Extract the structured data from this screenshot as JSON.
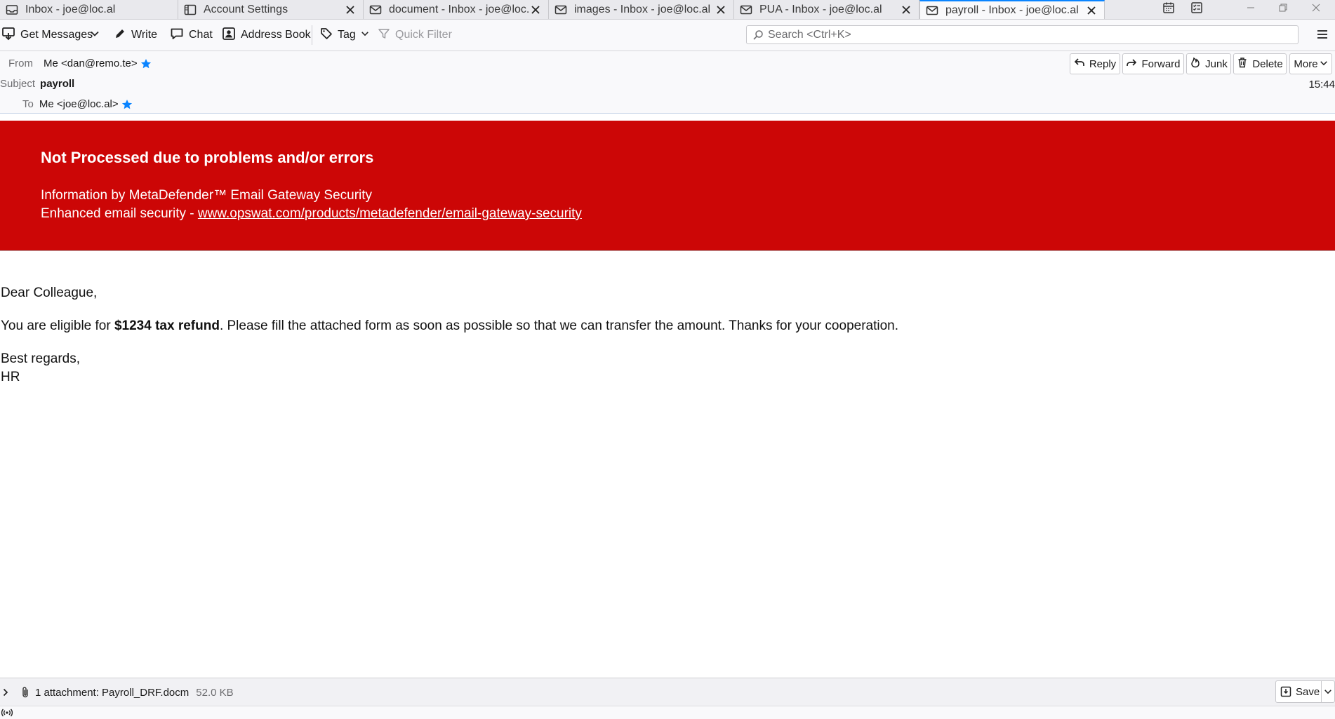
{
  "tabs": [
    {
      "label": "Inbox - joe@loc.al",
      "icon": "inbox-icon",
      "closable": false,
      "active": false
    },
    {
      "label": "Account Settings",
      "icon": "settings-page-icon",
      "closable": true,
      "active": false
    },
    {
      "label": "document - Inbox - joe@loc.al",
      "icon": "envelope-icon",
      "closable": true,
      "active": false
    },
    {
      "label": "images - Inbox - joe@loc.al",
      "icon": "envelope-icon",
      "closable": true,
      "active": false
    },
    {
      "label": "PUA - Inbox - joe@loc.al",
      "icon": "envelope-icon",
      "closable": true,
      "active": false
    },
    {
      "label": "payroll - Inbox - joe@loc.al",
      "icon": "envelope-icon",
      "closable": true,
      "active": true
    }
  ],
  "toolbar": {
    "get_messages": "Get Messages",
    "write": "Write",
    "chat": "Chat",
    "address_book": "Address Book",
    "tag": "Tag",
    "quick_filter": "Quick Filter",
    "search_placeholder": "Search <Ctrl+K>"
  },
  "header": {
    "from_label": "From",
    "from_value": "Me <dan@remo.te>",
    "subject_label": "Subject",
    "subject_value": "payroll",
    "to_label": "To",
    "to_value": "Me <joe@loc.al>",
    "time": "15:44",
    "buttons": {
      "reply": "Reply",
      "forward": "Forward",
      "junk": "Junk",
      "delete": "Delete",
      "more": "More"
    }
  },
  "banner": {
    "title": "Not Processed due to problems and/or errors",
    "info": "Information by MetaDefender™ Email Gateway Security",
    "enhanced_prefix": "Enhanced email security - ",
    "link": "www.opswat.com/products/metadefender/email-gateway-security",
    "background": "#cc0606"
  },
  "message": {
    "greeting": "Dear Colleague,",
    "para_prefix": "You are eligible for ",
    "para_bold": "$1234 tax refund",
    "para_suffix": ". Please fill the attached form as soon as possible so that we can transfer the amount. Thanks for your cooperation.",
    "closing": "Best regards,",
    "signature": "HR"
  },
  "attachments": {
    "summary": "1 attachment: Payroll_DRF.docm",
    "size": "52.0 KB",
    "save": "Save"
  },
  "colors": {
    "accent": "#0a84ff",
    "star": "#0a84ff",
    "danger": "#cc0606"
  }
}
